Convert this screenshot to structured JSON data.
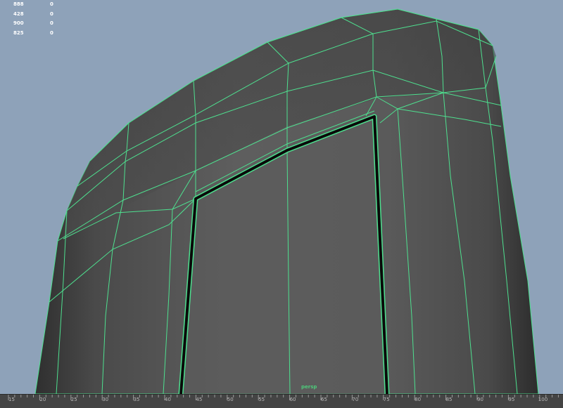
{
  "viewport": {
    "camera_label": "persp",
    "colors": {
      "background": "#8ea2b9",
      "mesh_fill": "#5a5a5a",
      "wireframe": "#4ee08f",
      "selected_edge": "#0a0a0a"
    }
  },
  "hud": {
    "rows": [
      {
        "label": "888",
        "value": "0"
      },
      {
        "label": "428",
        "value": "0"
      },
      {
        "label": "900",
        "value": "0"
      },
      {
        "label": "825",
        "value": "0"
      }
    ]
  },
  "timeline": {
    "labels": [
      "15",
      "20",
      "25",
      "30",
      "35",
      "40",
      "45",
      "50",
      "55",
      "60",
      "65",
      "70",
      "75",
      "80",
      "85",
      "90",
      "95",
      "100"
    ]
  }
}
